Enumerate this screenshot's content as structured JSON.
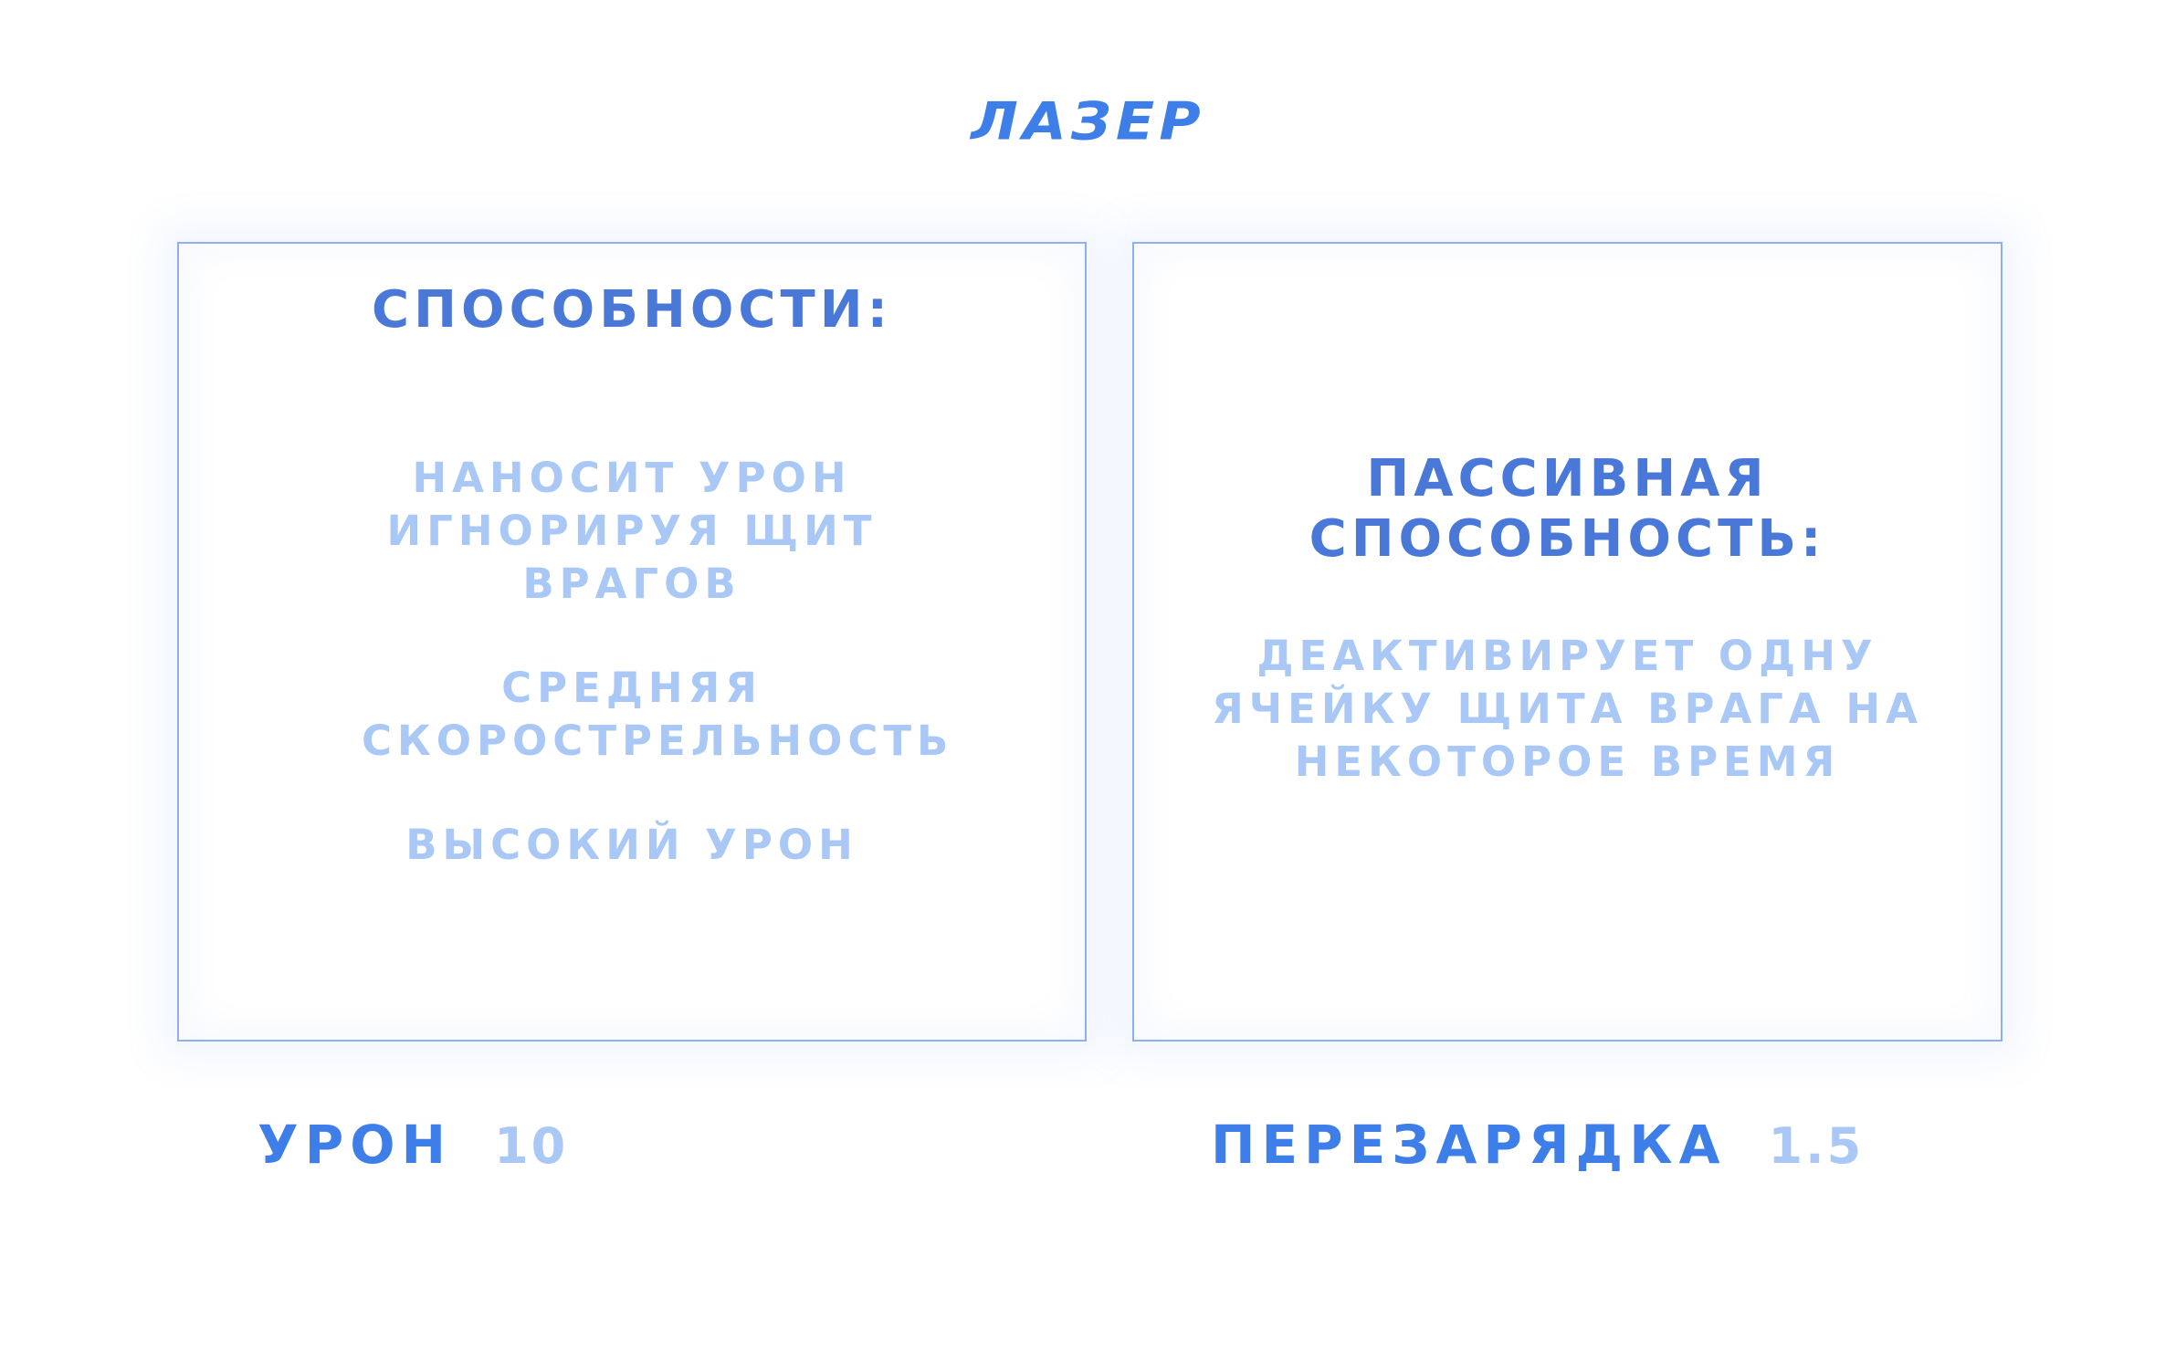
{
  "weapon": {
    "name": "ЛАЗЕР"
  },
  "abilities_panel": {
    "heading": "СПОСОБНОСТИ:",
    "items": [
      {
        "text": "НАНОСИТ УРОН ИГНОРИРУЯ ЩИТ ВРАГОВ"
      },
      {
        "text": "СРЕДНЯЯ СКОРОСТРЕЛЬНОСТЬ"
      },
      {
        "text": "ВЫСОКИЙ УРОН"
      }
    ]
  },
  "passive_panel": {
    "heading": "ПАССИВНАЯ СПОСОБНОСТЬ:",
    "description": "ДЕАКТИВИРУЕТ ОДНУ ЯЧЕЙКУ ЩИТА ВРАГА НА НЕКОТОРОЕ ВРЕМЯ"
  },
  "stats": {
    "damage_label": "УРОН",
    "damage_value": "10",
    "reload_label": "ПЕРЕЗАРЯДКА",
    "reload_value": "1.5"
  },
  "colors": {
    "accent": "#3e7ee8",
    "heading": "#4a78d8",
    "muted": "#a9c8f5",
    "panel_border": "#8fb0ee"
  }
}
